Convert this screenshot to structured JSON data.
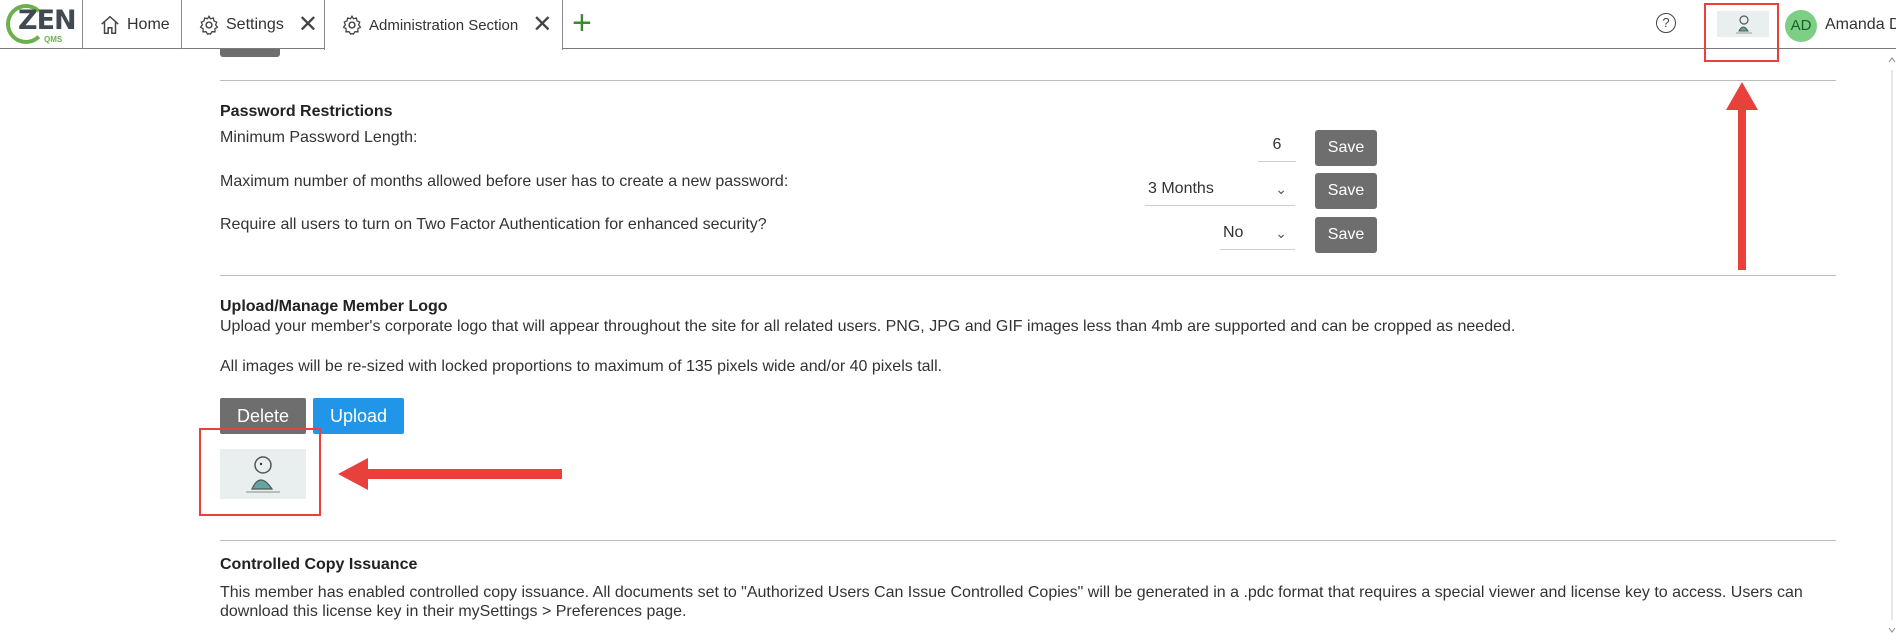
{
  "tabs": {
    "home": "Home",
    "settings": "Settings",
    "admin": "Administration Section"
  },
  "header": {
    "logo_text": "ZEN",
    "logo_sub": "QMS",
    "help_glyph": "?",
    "avatar_initials": "AD",
    "user_name": "Amanda D"
  },
  "password": {
    "heading": "Password Restrictions",
    "min_length_label": "Minimum Password Length:",
    "min_length_value": "6",
    "max_months_label": "Maximum number of months allowed before user has to create a new password:",
    "max_months_value": "3 Months",
    "two_factor_label": "Require all users to turn on Two Factor Authentication for enhanced security?",
    "two_factor_value": "No",
    "save_label": "Save"
  },
  "logo_section": {
    "heading": "Upload/Manage Member Logo",
    "desc": "Upload your member's corporate logo that will appear throughout the site for all related users. PNG, JPG and GIF images less than 4mb are supported and can be cropped as needed.",
    "note": "All images will be re-sized with locked proportions to maximum of 135 pixels wide and/or 40 pixels tall.",
    "delete_label": "Delete",
    "upload_label": "Upload"
  },
  "controlled_copy": {
    "heading": "Controlled Copy Issuance",
    "line1": "This member has enabled controlled copy issuance. All documents set to \"Authorized Users Can Issue Controlled Copies\" will be generated in a .pdc format that requires a special viewer and license key to access. Users can",
    "line2": "download this license key in their mySettings > Preferences page."
  },
  "colors": {
    "accent_green": "#6ab04c",
    "save_gray": "#6e6e6e",
    "upload_blue": "#2196e8",
    "annotation_red": "#e8413c"
  },
  "icons": [
    "home-icon",
    "gear-icon",
    "close-icon",
    "plus-icon",
    "help-icon",
    "chevron-down-icon"
  ]
}
